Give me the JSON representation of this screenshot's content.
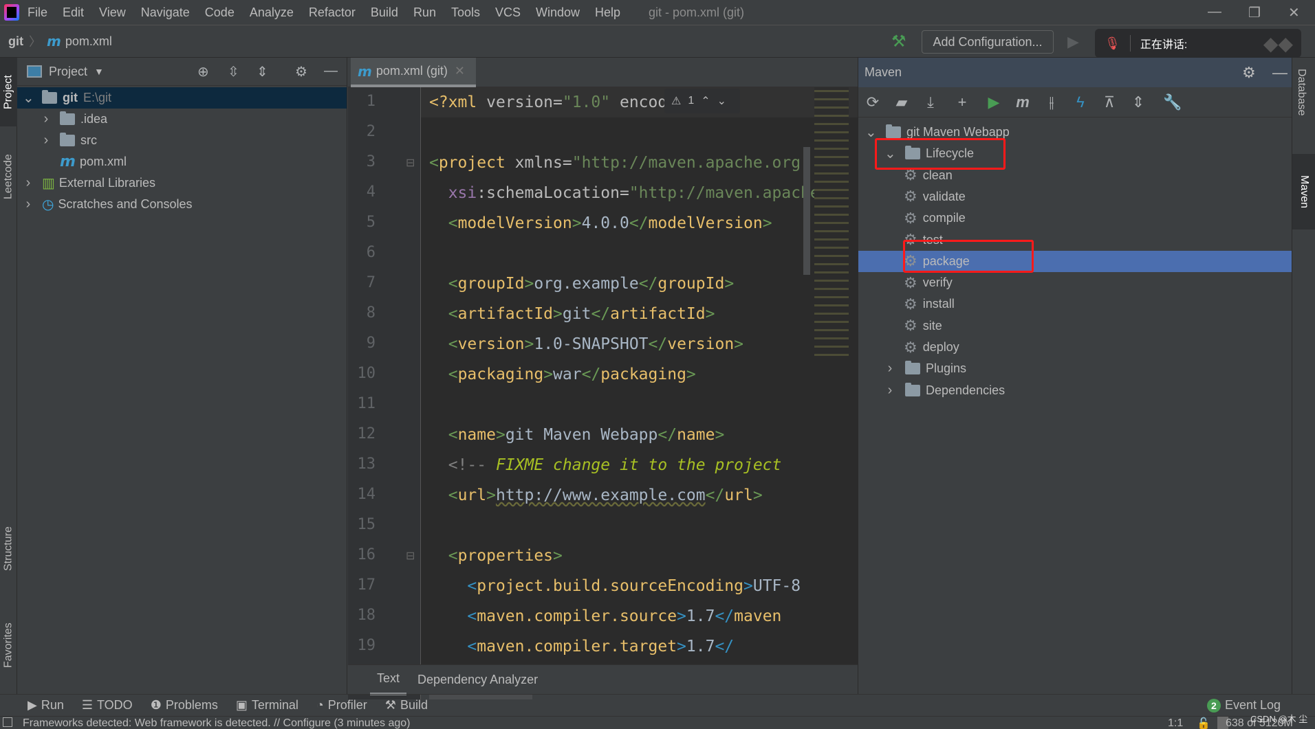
{
  "menubar": {
    "items": [
      "File",
      "Edit",
      "View",
      "Navigate",
      "Code",
      "Analyze",
      "Refactor",
      "Build",
      "Run",
      "Tools",
      "VCS",
      "Window",
      "Help"
    ],
    "title": "git - pom.xml (git)"
  },
  "navbar": {
    "project": "git",
    "file": "pom.xml",
    "file_icon": "m",
    "add_configuration": "Add Configuration...",
    "voice_status": "正在讲话:"
  },
  "left_stripe": {
    "tabs": [
      "Project",
      "Leetcode",
      "Structure",
      "Favorites"
    ]
  },
  "right_stripe": {
    "tabs": [
      "Database",
      "Maven"
    ]
  },
  "project": {
    "title": "Project",
    "tree": [
      {
        "label": "git",
        "sub": "E:\\git",
        "level": 0,
        "expanded": true,
        "icon": "module-folder-icon",
        "selected": true
      },
      {
        "label": ".idea",
        "level": 1,
        "expanded": false,
        "icon": "folder-icon"
      },
      {
        "label": "src",
        "level": 1,
        "expanded": false,
        "icon": "folder-icon"
      },
      {
        "label": "pom.xml",
        "level": 1,
        "icon": "maven-file-icon"
      },
      {
        "label": "External Libraries",
        "level": 0,
        "expanded": false,
        "icon": "libraries-icon"
      },
      {
        "label": "Scratches and Consoles",
        "level": 0,
        "expanded": false,
        "icon": "scratches-icon"
      }
    ]
  },
  "editor": {
    "tab": "pom.xml (git)",
    "warnings": "1",
    "lines": [
      [
        [
          "pi",
          "<?xml"
        ],
        [
          "attr",
          " version="
        ],
        [
          "val",
          "\"1.0\""
        ],
        [
          "attr",
          " encoding="
        ]
      ],
      [],
      [
        [
          "br",
          "<"
        ],
        [
          "tag",
          "project"
        ],
        [
          "attr",
          " xmlns="
        ],
        [
          "val",
          "\"http://maven.apache.org"
        ]
      ],
      [
        [
          "txt",
          "  "
        ],
        [
          "ns",
          "xsi"
        ],
        [
          "attr",
          ":schemaLocation="
        ],
        [
          "val",
          "\"http://maven.apache"
        ]
      ],
      [
        [
          "txt",
          "  "
        ],
        [
          "br",
          "<"
        ],
        [
          "tag",
          "modelVersion"
        ],
        [
          "br",
          ">"
        ],
        [
          "txt",
          "4.0.0"
        ],
        [
          "br",
          "</"
        ],
        [
          "tag",
          "modelVersion"
        ],
        [
          "br",
          ">"
        ]
      ],
      [],
      [
        [
          "txt",
          "  "
        ],
        [
          "br",
          "<"
        ],
        [
          "tag",
          "groupId"
        ],
        [
          "br",
          ">"
        ],
        [
          "txt",
          "org.example"
        ],
        [
          "br",
          "</"
        ],
        [
          "tag",
          "groupId"
        ],
        [
          "br",
          ">"
        ]
      ],
      [
        [
          "txt",
          "  "
        ],
        [
          "br",
          "<"
        ],
        [
          "tag",
          "artifactId"
        ],
        [
          "br",
          ">"
        ],
        [
          "txt",
          "git"
        ],
        [
          "br",
          "</"
        ],
        [
          "tag",
          "artifactId"
        ],
        [
          "br",
          ">"
        ]
      ],
      [
        [
          "txt",
          "  "
        ],
        [
          "br",
          "<"
        ],
        [
          "tag",
          "version"
        ],
        [
          "br",
          ">"
        ],
        [
          "txt",
          "1.0-SNAPSHOT"
        ],
        [
          "br",
          "</"
        ],
        [
          "tag",
          "version"
        ],
        [
          "br",
          ">"
        ]
      ],
      [
        [
          "txt",
          "  "
        ],
        [
          "br",
          "<"
        ],
        [
          "tag",
          "packaging"
        ],
        [
          "br",
          ">"
        ],
        [
          "txt",
          "war"
        ],
        [
          "br",
          "</"
        ],
        [
          "tag",
          "packaging"
        ],
        [
          "br",
          ">"
        ]
      ],
      [],
      [
        [
          "txt",
          "  "
        ],
        [
          "br",
          "<"
        ],
        [
          "tag",
          "name"
        ],
        [
          "br",
          ">"
        ],
        [
          "txt",
          "git Maven Webapp"
        ],
        [
          "br",
          "</"
        ],
        [
          "tag",
          "name"
        ],
        [
          "br",
          ">"
        ]
      ],
      [
        [
          "txt",
          "  "
        ],
        [
          "cm",
          "<!-- "
        ],
        [
          "todo",
          "FIXME change it to the project"
        ]
      ],
      [
        [
          "txt",
          "  "
        ],
        [
          "br",
          "<"
        ],
        [
          "tag",
          "url"
        ],
        [
          "br",
          ">"
        ],
        [
          "url",
          "http://www.example.com"
        ],
        [
          "br",
          "</"
        ],
        [
          "tag",
          "url"
        ],
        [
          "br",
          ">"
        ]
      ],
      [],
      [
        [
          "txt",
          "  "
        ],
        [
          "br",
          "<"
        ],
        [
          "tag",
          "properties"
        ],
        [
          "br",
          ">"
        ]
      ],
      [
        [
          "txt",
          "    "
        ],
        [
          "br2",
          "<"
        ],
        [
          "tag",
          "project.build.sourceEncoding"
        ],
        [
          "br2",
          ">"
        ],
        [
          "txt",
          "UTF-8"
        ]
      ],
      [
        [
          "txt",
          "    "
        ],
        [
          "br2",
          "<"
        ],
        [
          "tag",
          "maven.compiler.source"
        ],
        [
          "br2",
          ">"
        ],
        [
          "txt",
          "1.7"
        ],
        [
          "br2",
          "</"
        ],
        [
          "tag",
          "maven"
        ]
      ],
      [
        [
          "txt",
          "    "
        ],
        [
          "br2",
          "<"
        ],
        [
          "tag",
          "maven.compiler.target"
        ],
        [
          "br2",
          ">"
        ],
        [
          "txt",
          "1.7"
        ],
        [
          "br2",
          "</"
        ]
      ]
    ],
    "bottom_tabs": [
      "Text",
      "Dependency Analyzer"
    ],
    "active_bottom_tab": "Text"
  },
  "maven": {
    "title": "Maven",
    "root": "git Maven Webapp",
    "lifecycle": "Lifecycle",
    "goals": [
      "clean",
      "validate",
      "compile",
      "test",
      "package",
      "verify",
      "install",
      "site",
      "deploy"
    ],
    "selected_goal": "package",
    "plugins": "Plugins",
    "dependencies": "Dependencies",
    "toolbar": [
      "reload-icon",
      "generate-sources-icon",
      "download-icon",
      "add-icon",
      "run-icon",
      "execute-goal-icon",
      "toggle-offline-icon",
      "skip-tests-icon",
      "show-dependencies-icon",
      "collapse-all-icon",
      "settings-wrench-icon"
    ]
  },
  "toolwindows": {
    "items": [
      "Run",
      "TODO",
      "Problems",
      "Terminal",
      "Profiler",
      "Build"
    ],
    "event_log": "Event Log",
    "event_count": "2"
  },
  "status": {
    "message": "Frameworks detected: Web framework is detected. // Configure (3 minutes ago)",
    "position": "1:1",
    "memory": "638 of 5120M",
    "watermark": "CSDN @木 尘"
  },
  "colors": {
    "accent": "#4b6eaf",
    "highlight": "#ff1a1a",
    "run": "#499c54"
  }
}
